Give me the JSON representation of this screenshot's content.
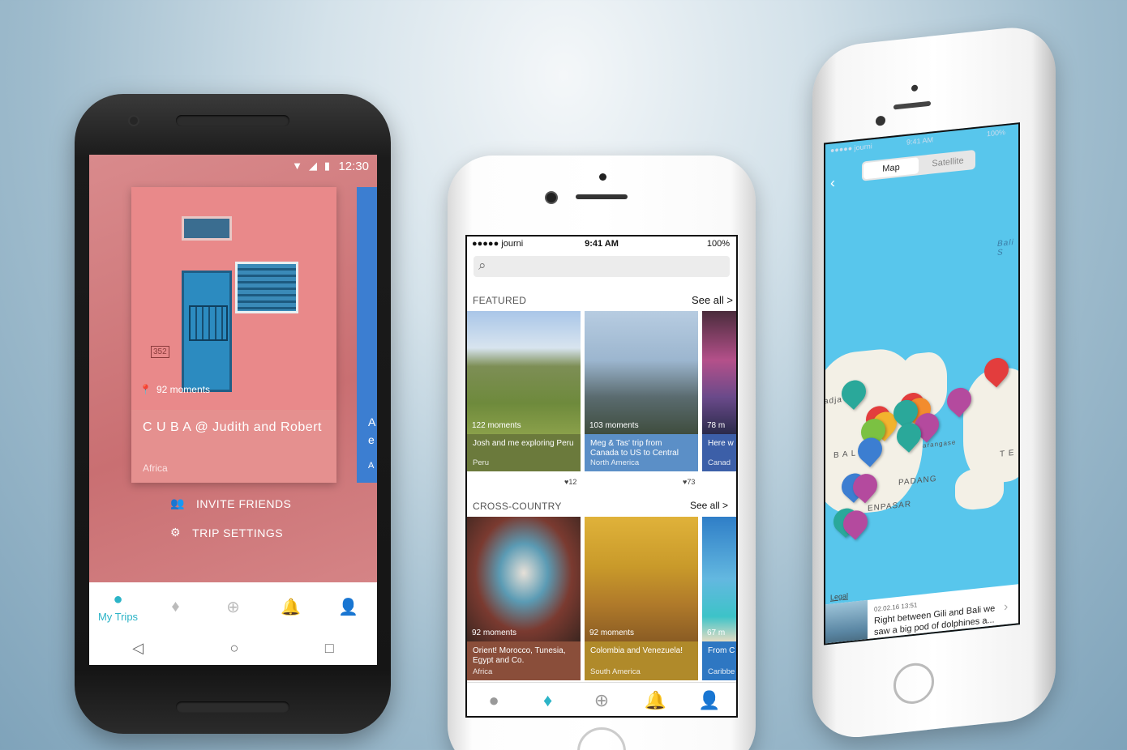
{
  "android": {
    "status": {
      "time": "12:30"
    },
    "card": {
      "moments": "92 moments",
      "title": "C U B A @ Judith and Robert",
      "region": "Africa",
      "door_number": "352"
    },
    "side_card": {
      "line1": "A",
      "line2": "e",
      "line3": "A"
    },
    "menu": {
      "invite": "INVITE FRIENDS",
      "settings": "TRIP SETTINGS"
    },
    "tabs": [
      {
        "label": "My Trips",
        "icon": "globe-icon"
      },
      {
        "icon": "feather-icon"
      },
      {
        "icon": "plus-icon"
      },
      {
        "icon": "bell-icon"
      },
      {
        "icon": "user-icon"
      }
    ],
    "nav": [
      "◁",
      "○",
      "□"
    ]
  },
  "iphone": {
    "status": {
      "carrier": "●●●●● journi",
      "time": "9:41 AM",
      "battery": "100%"
    },
    "featured": {
      "heading": "FEATURED",
      "see_all": "See all >",
      "tiles": [
        {
          "moments": "122 moments",
          "title": "Josh and me exploring Peru",
          "region": "Peru",
          "likes": "♥12",
          "color": "#6b7a3c"
        },
        {
          "moments": "103 moments",
          "title": "Meg & Tas' trip from Canada to US to Central",
          "region": "North America",
          "likes": "♥73",
          "color": "#5b8fc7"
        },
        {
          "moments": "78 m",
          "title": "Here w Luisa a",
          "region": "Canad",
          "color": "#3c5fa8"
        }
      ]
    },
    "cross": {
      "heading": "CROSS-COUNTRY",
      "see_all": "See all >",
      "tiles": [
        {
          "moments": "92 moments",
          "title": "Orient! Morocco, Tunesia, Egypt and Co.",
          "region": "Africa",
          "color": "#8a4e3a"
        },
        {
          "moments": "92 moments",
          "title": "Colombia and Venezuela!",
          "region": "South America",
          "color": "#b08a2a"
        },
        {
          "moments": "67 m",
          "title": "From C Domini",
          "region": "Caribbe",
          "color": "#2e77c2"
        }
      ]
    },
    "tabs": [
      {
        "icon": "globe-icon"
      },
      {
        "icon": "feather-icon"
      },
      {
        "icon": "plus-icon"
      },
      {
        "icon": "bell-icon"
      },
      {
        "icon": "user-icon"
      }
    ]
  },
  "map_phone": {
    "status": {
      "carrier": "●●●●● journi",
      "time": "9:41 AM",
      "battery": "100%"
    },
    "segments": [
      "Map",
      "Satellite"
    ],
    "labels": {
      "bali": "Bali S",
      "bal": "B A L",
      "padang": "PADANG",
      "denpasar": "ENPASAR",
      "karangasem": "arangase",
      "te": "T E",
      "adja": "adja",
      "ng": "ng"
    },
    "legal": "Legal",
    "moment": {
      "date": "02.02.16   13:51",
      "text": "Right between Gili and Bali we saw a big pod of dolphines a..."
    }
  }
}
